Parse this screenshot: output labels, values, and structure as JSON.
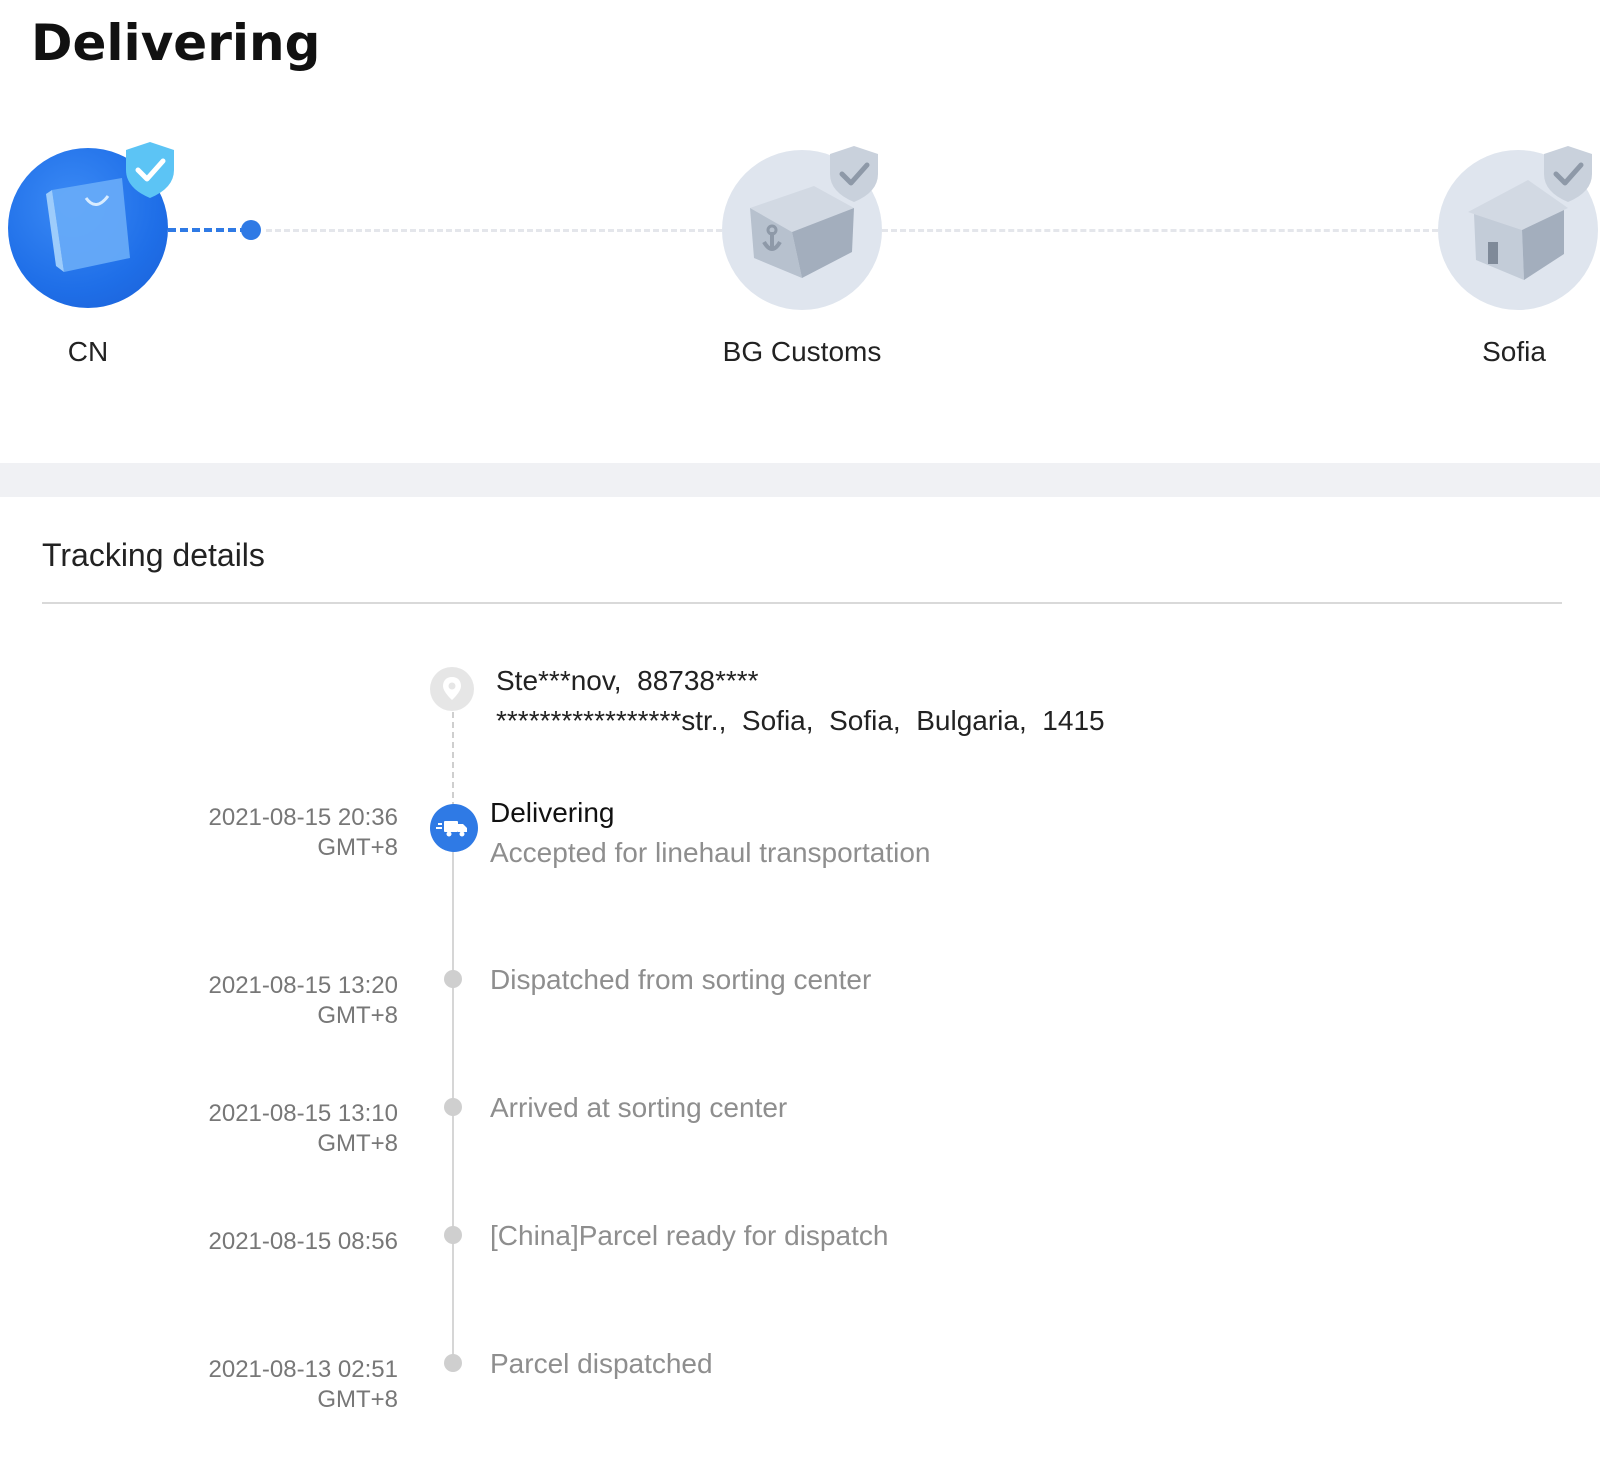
{
  "status": {
    "title": "Delivering"
  },
  "progress": {
    "stages": [
      {
        "label": "CN",
        "state": "done",
        "icon": "shopping-bag-icon"
      },
      {
        "label": "BG Customs",
        "state": "pending",
        "icon": "customs-box-icon"
      },
      {
        "label": "Sofia",
        "state": "pending",
        "icon": "house-icon"
      }
    ],
    "colors": {
      "accent": "#2f7ae5",
      "pending": "#dfe5ee",
      "shield_done": "#5cc4f5",
      "shield_pending": "#c9d1dc"
    }
  },
  "tracking": {
    "title": "Tracking details",
    "address": {
      "icon": "location-pin-icon",
      "line1": "Ste***nov,  88738****",
      "line2": "*****************str.,  Sofia,  Sofia,  Bulgaria,  1415"
    },
    "events": [
      {
        "date": "2021-08-15 20:36",
        "tz": "GMT+8",
        "title": "Delivering",
        "text": "Accepted for linehaul transportation",
        "icon": "truck-icon",
        "current": true
      },
      {
        "date": "2021-08-15 13:20",
        "tz": "GMT+8",
        "text": "Dispatched from sorting center"
      },
      {
        "date": "2021-08-15 13:10",
        "tz": "GMT+8",
        "text": "Arrived at sorting center"
      },
      {
        "date": "2021-08-15 08:56",
        "tz": "",
        "text": "[China]Parcel ready for dispatch"
      },
      {
        "date": "2021-08-13 02:51",
        "tz": "GMT+8",
        "text": "Parcel dispatched"
      }
    ]
  }
}
